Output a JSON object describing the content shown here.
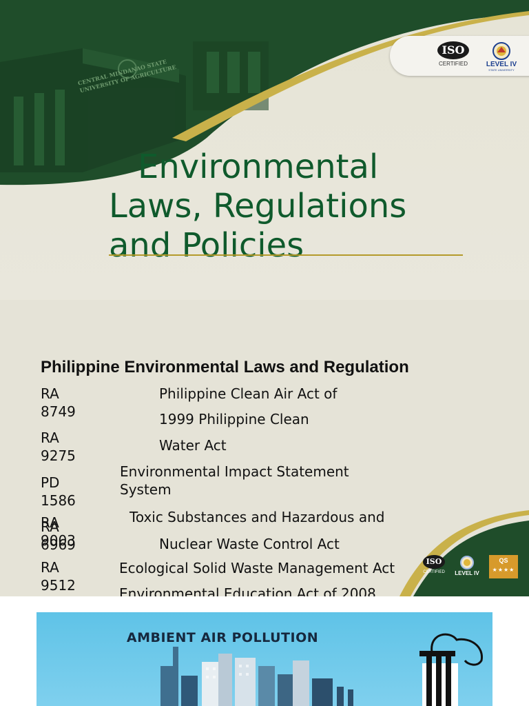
{
  "slide1": {
    "title_lines": [
      "Environmental",
      "Laws, Regulations",
      "and Policies"
    ],
    "building_sign": [
      "CENTRAL MINDANAO STATE",
      "UNIVERSITY OF AGRICULTURE"
    ],
    "iso_mark": "ISO",
    "iso_caption": "CERTIFIED",
    "level_caption": "LEVEL IV",
    "level_subcaption": "STATE UNIVERSITY"
  },
  "slide2": {
    "heading": "Philippine Environmental Laws and Regulation",
    "law_codes": [
      "RA\n8749",
      "RA\n9275",
      "PD\n1586",
      "RA\n6969",
      "RA\n9003",
      "RA\n9512"
    ],
    "law_texts": [
      "Philippine Clean Air Act of",
      "1999 Philippine Clean",
      "Water Act",
      "Environmental Impact Statement",
      "System",
      "Toxic Substances and Hazardous and",
      "Nuclear Waste Control Act",
      "Ecological Solid Waste Management Act",
      "Environmental Education Act of 2008"
    ],
    "badge_iso": "ISO",
    "badge_iso_caption": "CERTIFIED",
    "badge_level": "LEVEL IV",
    "badge_qs": "QS",
    "badge_qs_stars": "★★★★"
  },
  "slide3": {
    "poster_title": "AMBIENT AIR POLLUTION"
  },
  "colors": {
    "dark_green": "#0f5a2c",
    "gold": "#b49a2a",
    "cream": "#e7e5d9",
    "sky_blue": "#6cc8ea"
  }
}
